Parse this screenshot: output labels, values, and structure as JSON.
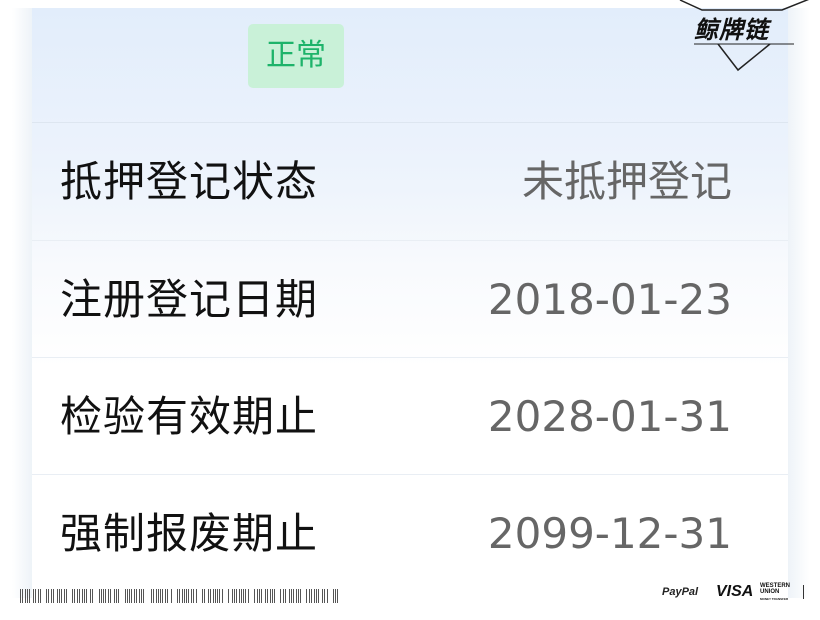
{
  "status": {
    "badge_text": "正常",
    "badge_color": "#1db36a",
    "badge_bg": "#c9f1d8"
  },
  "details": {
    "rows": [
      {
        "label": "抵押登记状态",
        "value": "未抵押登记"
      },
      {
        "label": "注册登记日期",
        "value": "2018-01-23"
      },
      {
        "label": "检验有效期止",
        "value": "2028-01-31"
      },
      {
        "label": "强制报废期止",
        "value": "2099-12-31"
      }
    ]
  },
  "watermark": {
    "logo_text": "鲸牌链"
  },
  "footer": {
    "payments": {
      "paypal": "PayPal",
      "visa": "VISA",
      "western_union_line1": "WESTERN",
      "western_union_line2": "UNION",
      "western_union_tagline": "MONEY TRANSFER"
    }
  },
  "colors": {
    "label_text": "#111111",
    "value_text": "#666666",
    "header_gradient_top": "#e2edfb"
  }
}
